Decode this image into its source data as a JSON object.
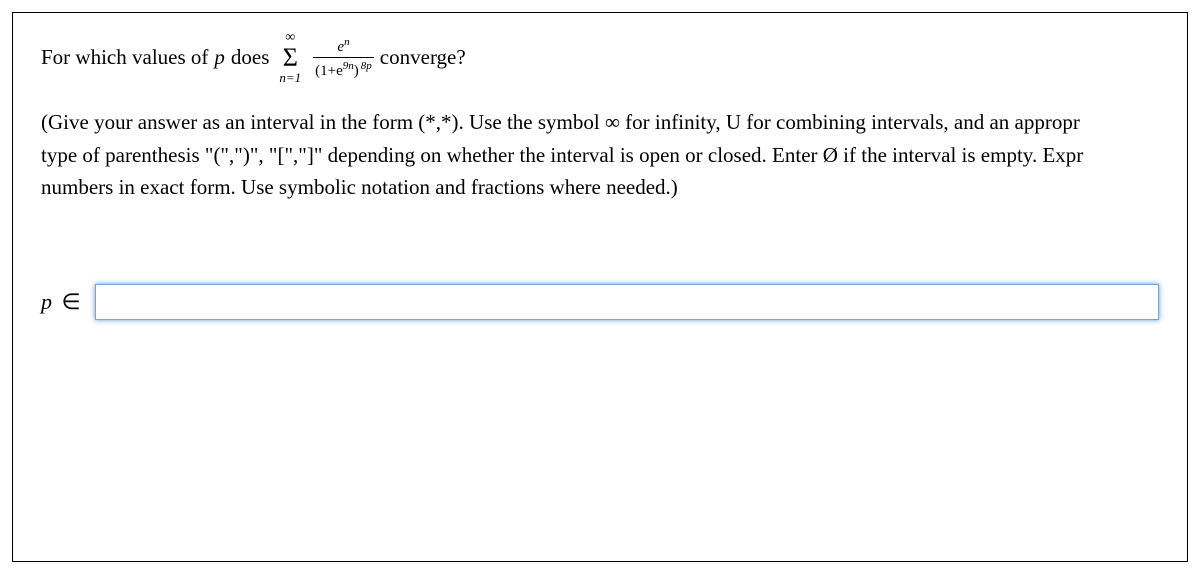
{
  "question": {
    "prefix": "For which values of",
    "var_p": "p",
    "does": "does",
    "sigma_top": "∞",
    "sigma_symbol": "Σ",
    "sigma_bottom": "n=1",
    "frac_num_base": "e",
    "frac_num_exp": "n",
    "frac_den_open": "(1+e",
    "frac_den_inner_exp": "9n",
    "frac_den_close": ")",
    "frac_den_outer_exp": "8p",
    "suffix": "converge?"
  },
  "instructions": {
    "line1a": "(Give your answer as an interval in the form (*,*). Use the symbol ",
    "inf": "∞",
    "line1b": " for infinity, U for combining intervals, and an appropr",
    "line2": "type of parenthesis \"(\",\")\", \"[\",\"]\" depending on whether the interval is open or closed. Enter Ø if the interval is empty. Expr",
    "line3": "numbers in exact form. Use symbolic notation and fractions where needed.)"
  },
  "answer": {
    "label_var": "p",
    "label_rel": "∈",
    "value": "",
    "placeholder": ""
  }
}
